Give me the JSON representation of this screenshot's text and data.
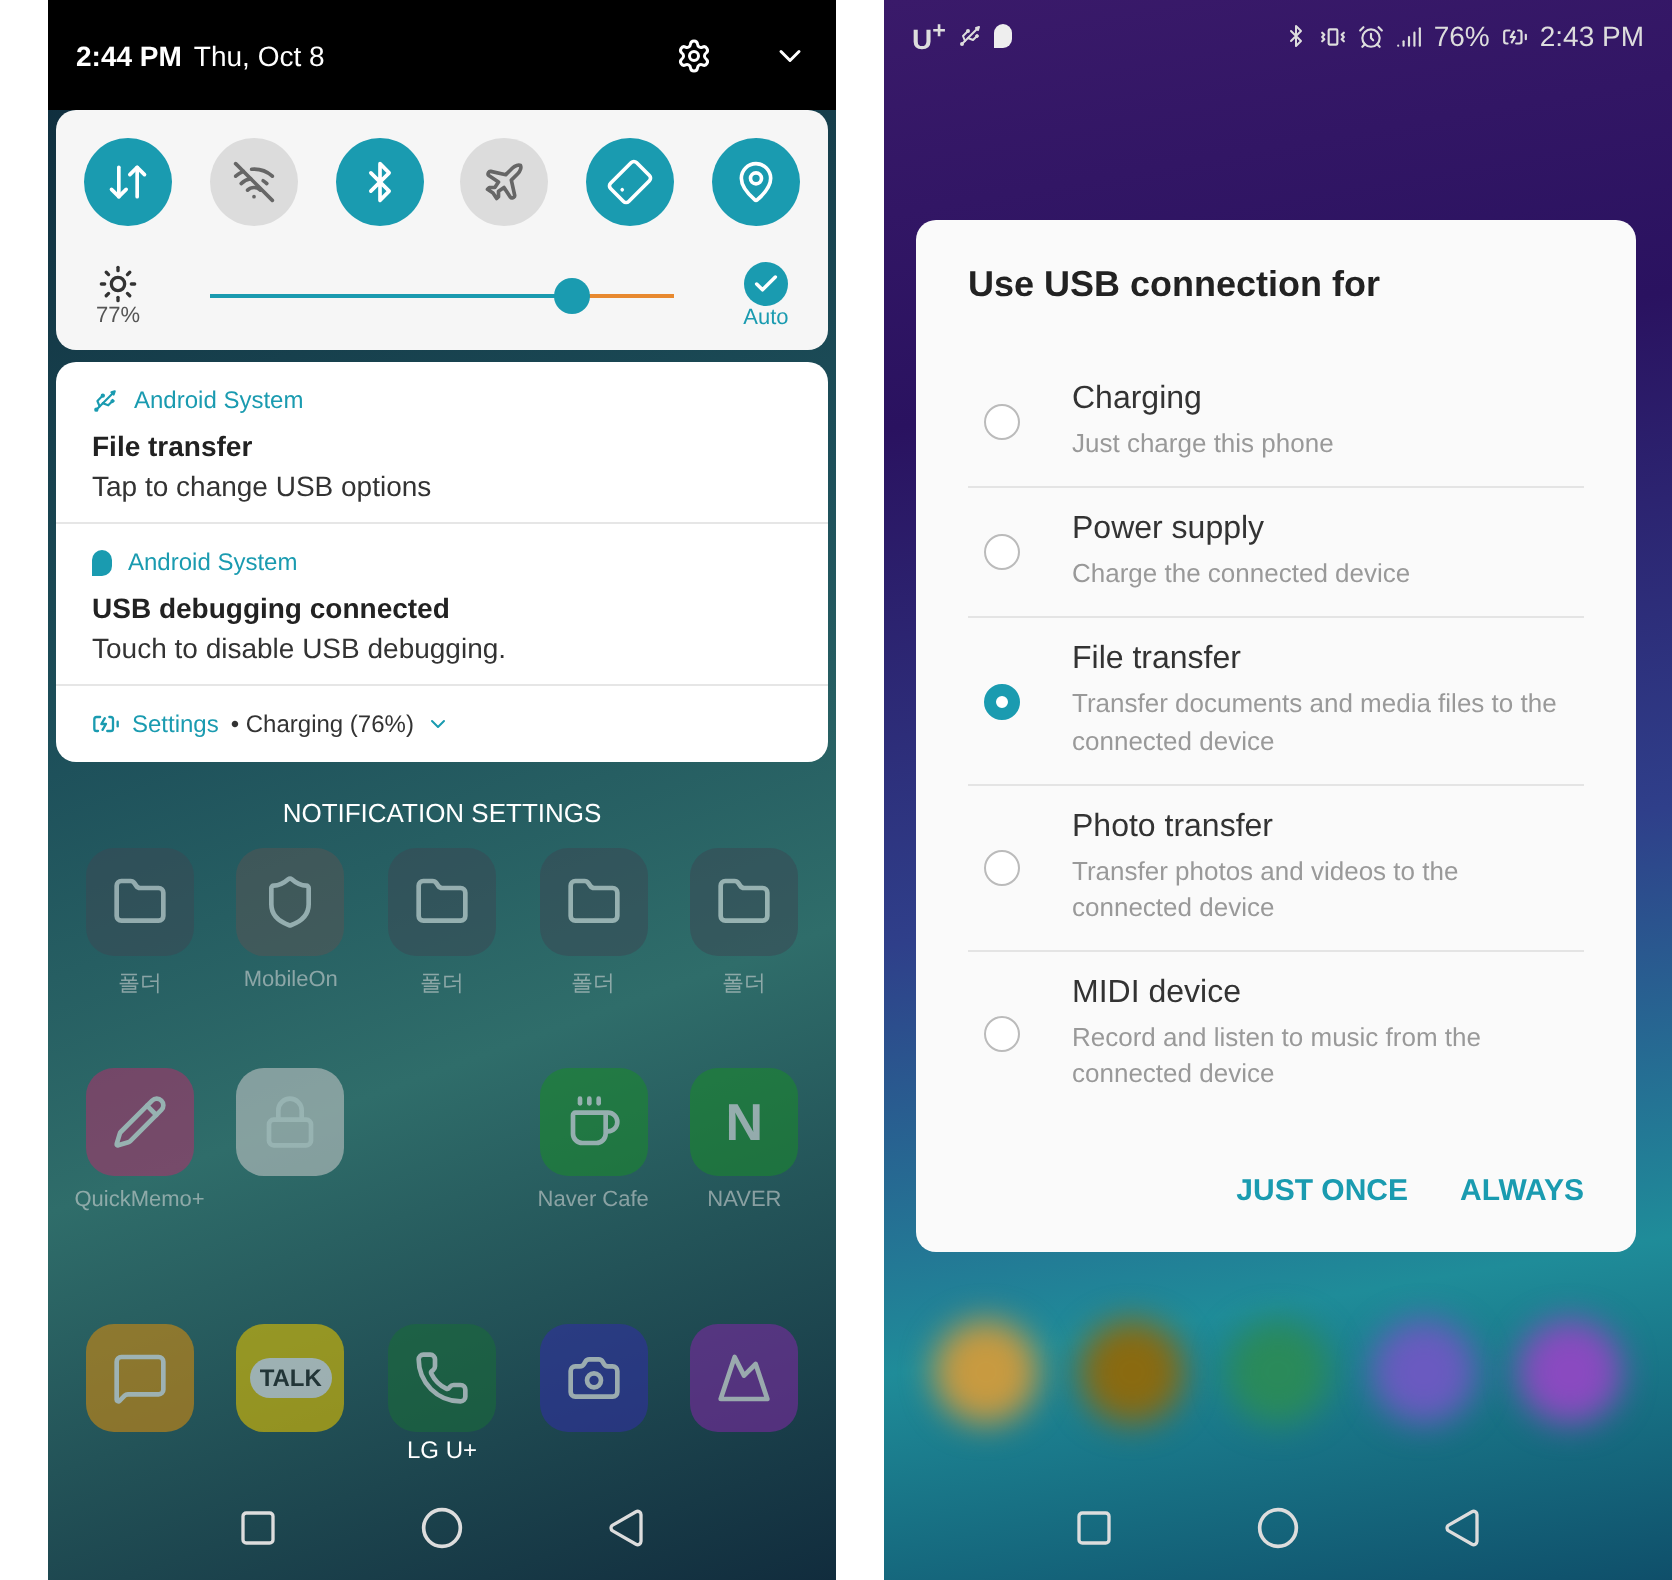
{
  "notification_shade": {
    "header": {
      "time": "2:44 PM",
      "date": "Thu, Oct 8"
    },
    "quick_toggles": [
      {
        "kind": "data",
        "on": true
      },
      {
        "kind": "wifi",
        "on": false
      },
      {
        "kind": "bluetooth",
        "on": true
      },
      {
        "kind": "airplane",
        "on": false
      },
      {
        "kind": "rotation",
        "on": true
      },
      {
        "kind": "location",
        "on": true
      }
    ],
    "brightness": {
      "level": 0.78,
      "reading": "77%",
      "auto_label": "Auto",
      "auto_checked": true
    },
    "notifications": [
      {
        "kind": "usb",
        "app": "Android System",
        "title": "File transfer",
        "text": "Tap to change USB options"
      },
      {
        "kind": "debug",
        "app": "Android System",
        "title": "USB debugging connected",
        "text": "Touch to disable USB debugging."
      }
    ],
    "footer": {
      "app": "Settings",
      "text": "• Charging (76%)"
    },
    "notification_settings": "NOTIFICATION SETTINGS",
    "home_apps": [
      {
        "kind": "folder",
        "label": "폴더"
      },
      {
        "kind": "shield",
        "label": "MobileOn"
      },
      {
        "kind": "folder",
        "label": "폴더"
      },
      {
        "kind": "folder",
        "label": "폴더"
      },
      {
        "kind": "folder",
        "label": "폴더"
      },
      {
        "kind": "memo",
        "label": "QuickMemo+"
      },
      {
        "kind": "lock"
      },
      {
        "kind": "empty"
      },
      {
        "kind": "cafe",
        "label": "Naver Cafe"
      },
      {
        "kind": "naver",
        "glyph": "N",
        "label": "NAVER"
      }
    ],
    "dock_apps": [
      {
        "kind": "messages"
      },
      {
        "kind": "talk",
        "glyph": "TALK"
      },
      {
        "kind": "phone",
        "label": "LG U+"
      },
      {
        "kind": "camera"
      },
      {
        "kind": "gallery"
      }
    ]
  },
  "usb_screen": {
    "status_bar": {
      "carrier": "U$^{+}$",
      "battery": "76%",
      "time": "2:43 PM"
    },
    "dialog": {
      "title": "Use USB connection for",
      "options": [
        {
          "label": "Charging",
          "description": "Just charge this phone",
          "selected": false
        },
        {
          "label": "Power supply",
          "description": "Charge the connected device",
          "selected": false
        },
        {
          "label": "File transfer",
          "description": "Transfer documents and media files to the connected device",
          "selected": true
        },
        {
          "label": "Photo transfer",
          "description": "Transfer photos and videos to the connected device",
          "selected": false
        },
        {
          "label": "MIDI device",
          "description": "Record and listen to music from the connected device",
          "selected": false
        }
      ],
      "buttons": [
        "JUST ONCE",
        "ALWAYS"
      ]
    }
  }
}
